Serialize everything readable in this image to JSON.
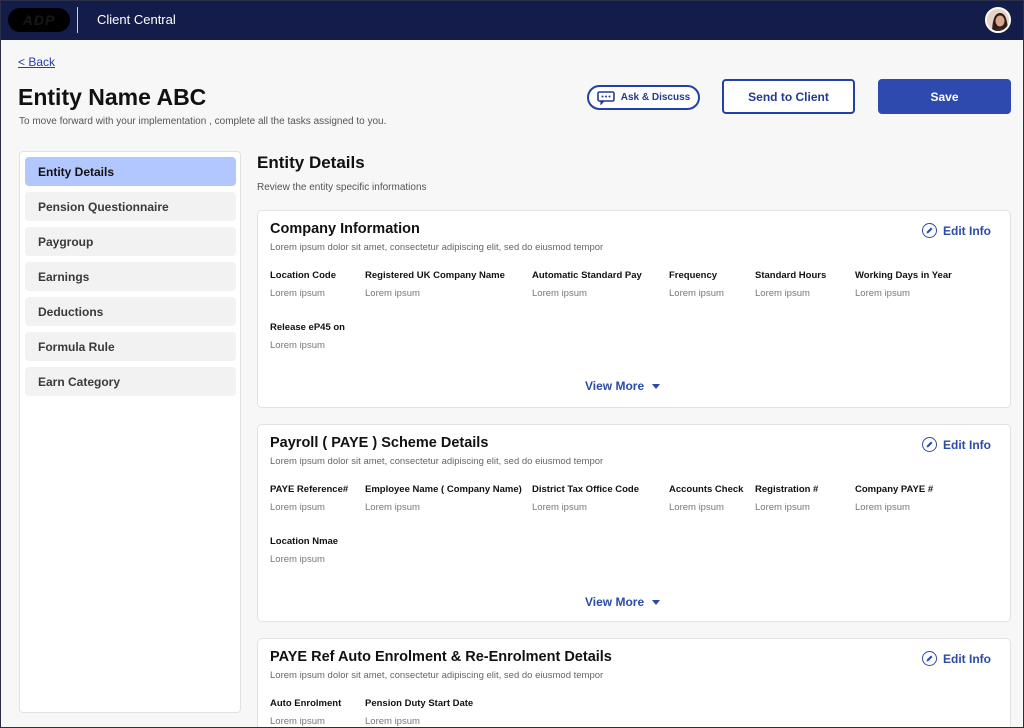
{
  "header": {
    "logo_text": "ADP",
    "app_title": "Client Central"
  },
  "page": {
    "back_label": "< Back",
    "title": "Entity Name ABC",
    "subtitle": "To move forward with your implementation , complete all the tasks assigned to you.",
    "ask_label": "Ask & Discuss",
    "send_label": "Send to Client",
    "save_label": "Save"
  },
  "sidebar": {
    "items": [
      {
        "label": "Entity Details",
        "active": true
      },
      {
        "label": "Pension Questionnaire"
      },
      {
        "label": "Paygroup"
      },
      {
        "label": "Earnings"
      },
      {
        "label": "Deductions"
      },
      {
        "label": "Formula Rule"
      },
      {
        "label": "Earn Category"
      }
    ]
  },
  "main": {
    "title": "Entity Details",
    "subtitle": "Review the entity specific informations",
    "edit_label": "Edit Info",
    "view_more_label": "View More",
    "cards": [
      {
        "title": "Company Information",
        "desc": "Lorem ipsum dolor sit amet, consectetur adipiscing elit, sed do eiusmod tempor",
        "fields": [
          {
            "label": "Location Code",
            "value": "Lorem ipsum"
          },
          {
            "label": "Registered UK Company Name",
            "value": "Lorem ipsum"
          },
          {
            "label": "Automatic Standard Pay",
            "value": "Lorem ipsum"
          },
          {
            "label": "Frequency",
            "value": "Lorem ipsum"
          },
          {
            "label": "Standard Hours",
            "value": "Lorem ipsum"
          },
          {
            "label": "Working Days in Year",
            "value": "Lorem ipsum"
          },
          {
            "label": "Release eP45 on",
            "value": "Lorem ipsum"
          }
        ]
      },
      {
        "title": "Payroll ( PAYE ) Scheme Details",
        "desc": "Lorem ipsum dolor sit amet, consectetur adipiscing elit, sed do eiusmod tempor",
        "fields": [
          {
            "label": "PAYE Reference#",
            "value": "Lorem ipsum"
          },
          {
            "label": "Employee Name ( Company Name)",
            "value": "Lorem ipsum"
          },
          {
            "label": "District Tax Office Code",
            "value": "Lorem ipsum"
          },
          {
            "label": "Accounts Check",
            "value": "Lorem ipsum"
          },
          {
            "label": "Registration #",
            "value": "Lorem ipsum"
          },
          {
            "label": "Company PAYE #",
            "value": "Lorem ipsum"
          },
          {
            "label": "Location Nmae",
            "value": "Lorem ipsum"
          }
        ]
      },
      {
        "title": "PAYE Ref Auto Enrolment & Re-Enrolment Details",
        "desc": "Lorem ipsum dolor sit amet, consectetur adipiscing elit, sed do eiusmod tempor",
        "fields": [
          {
            "label": "Auto Enrolment",
            "value": "Lorem ipsum"
          },
          {
            "label": "Pension Duty Start Date",
            "value": "Lorem ipsum"
          }
        ]
      }
    ]
  }
}
